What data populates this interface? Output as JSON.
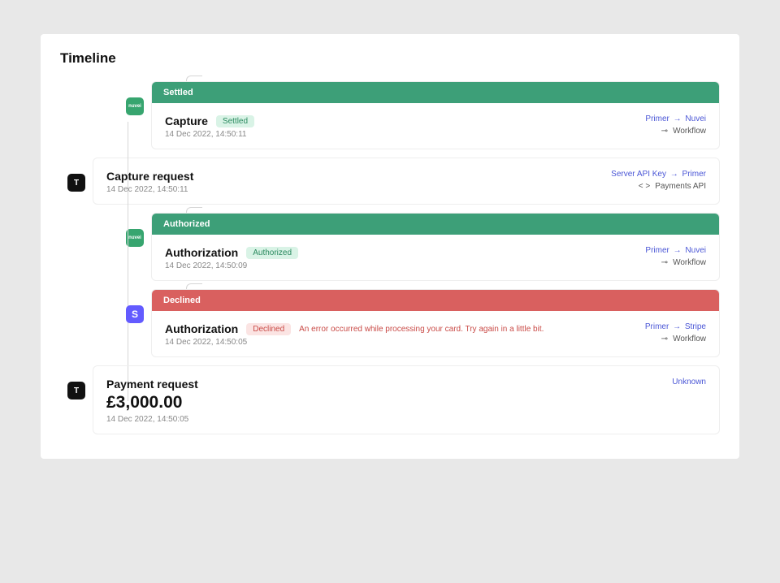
{
  "page_title": "Timeline",
  "icons": {
    "nuvei": "nuvei",
    "stripe": "S",
    "api": "T"
  },
  "routes": {
    "primer_nuvei_from": "Primer",
    "primer_nuvei_to": "Nuvei",
    "server_primer_from": "Server API Key",
    "server_primer_to": "Primer",
    "primer_stripe_from": "Primer",
    "primer_stripe_to": "Stripe",
    "unknown": "Unknown"
  },
  "meta": {
    "workflow": "Workflow",
    "payments_api": "Payments API"
  },
  "events": {
    "capture": {
      "status_bar": "Settled",
      "title": "Capture",
      "pill": "Settled",
      "ts": "14 Dec 2022, 14:50:11"
    },
    "capture_request": {
      "title": "Capture request",
      "ts": "14 Dec 2022, 14:50:11"
    },
    "auth_success": {
      "status_bar": "Authorized",
      "title": "Authorization",
      "pill": "Authorized",
      "ts": "14 Dec 2022, 14:50:09"
    },
    "auth_fail": {
      "status_bar": "Declined",
      "title": "Authorization",
      "pill": "Declined",
      "error": "An error occurred while processing your card. Try again in a little bit.",
      "ts": "14 Dec 2022, 14:50:05"
    },
    "payment_request": {
      "title": "Payment request",
      "amount": "£3,000.00",
      "ts": "14 Dec 2022, 14:50:05"
    }
  }
}
